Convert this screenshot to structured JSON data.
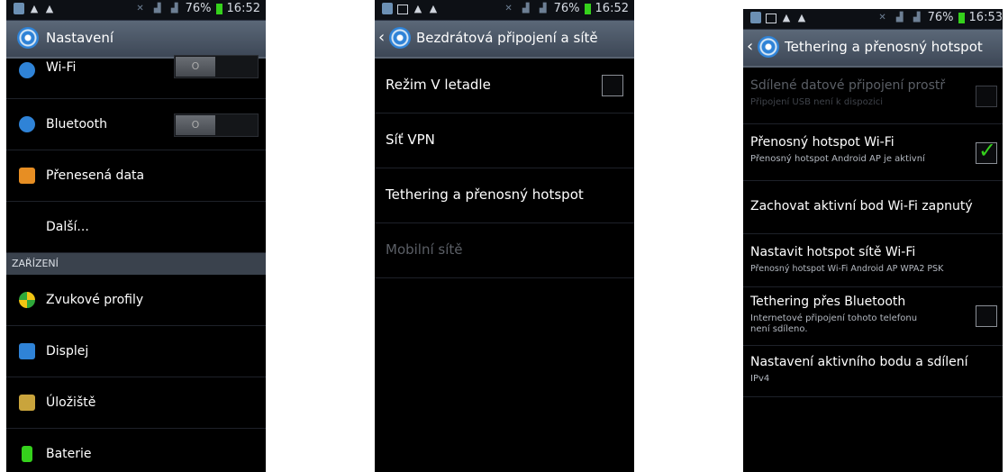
{
  "status": {
    "battery": "76%",
    "time": "16:52",
    "time_cut": "16:53"
  },
  "screen1": {
    "title": "Nastavení",
    "items_top": [
      {
        "label": "Wi-Fi",
        "toggle": "O"
      },
      {
        "label": "Bluetooth",
        "toggle": "O"
      },
      {
        "label": "Přenesená data"
      },
      {
        "label": "Další..."
      }
    ],
    "section": "ZAŘÍZENÍ",
    "items_bottom": [
      {
        "label": "Zvukové profily"
      },
      {
        "label": "Displej"
      },
      {
        "label": "Úložiště"
      },
      {
        "label": "Baterie"
      }
    ]
  },
  "screen2": {
    "title": "Bezdrátová připojení a sítě",
    "items": [
      {
        "label": "Režim V letadle"
      },
      {
        "label": "Síť VPN"
      },
      {
        "label": "Tethering a přenosný hotspot"
      },
      {
        "label": "Mobilní sítě"
      }
    ]
  },
  "screen3": {
    "title": "Tethering a přenosný hotspot",
    "items": [
      {
        "label": "Sdílené datové připojení prostř",
        "sub": "Připojení USB není k dispozici"
      },
      {
        "label": "Přenosný hotspot Wi-Fi",
        "sub": "Přenosný hotspot Android AP je aktivní",
        "check": "✓"
      },
      {
        "label": "Zachovat aktivní bod Wi-Fi zapnutý"
      },
      {
        "label": "Nastavit hotspot sítě Wi-Fi",
        "sub": "Přenosný hotspot Wi-Fi Android AP WPA2 PSK"
      },
      {
        "label": "Tethering přes Bluetooth",
        "sub": "Internetové připojení tohoto telefonu",
        "sub2": "není sdíleno."
      },
      {
        "label": "Nastavení aktivního bodu a sdílení",
        "sub": "IPv4"
      }
    ]
  },
  "colors": {
    "accent": "#2f83d7",
    "check": "#35d11c",
    "titlebar": "#4a5565"
  }
}
